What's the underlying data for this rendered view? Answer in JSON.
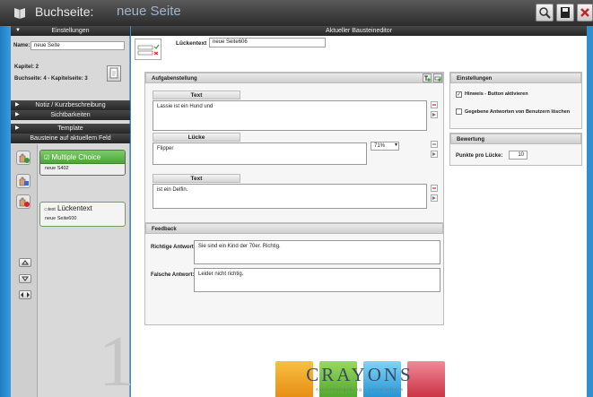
{
  "title": {
    "label": "Buchseite:",
    "value": "neue Seite"
  },
  "sidebar": {
    "settings_header": "Einstellungen",
    "name_label": "Name:",
    "name_value": "neue Seite",
    "chapter": "Kapitel: 2",
    "page_info": "Buchseite: 4  -  Kapitelseite: 3",
    "notes_header": "Notiz / Kurzbeschreibung",
    "visibility_header": "Sichtbarkeiten",
    "template_header": "Template",
    "blocks_header": "Bausteine auf aktuellem Feld",
    "blocks": [
      {
        "title": "Multiple Choice",
        "sub": "neue S402"
      },
      {
        "title": "Lückentext",
        "sub": "neue Seite600"
      }
    ],
    "watermark": "1"
  },
  "editor": {
    "header": "Aktueller Bausteineditor",
    "field_label": "Lückentext",
    "field_value": "neue Seite606",
    "task_header": "Aufgabenstellung",
    "blocks": [
      {
        "head": "Text",
        "content": "Lassie ist ein Hund und"
      },
      {
        "head": "Lücke",
        "content": "Flipper",
        "select": "71%"
      },
      {
        "head": "Text",
        "content": "ist ein Delfin."
      }
    ],
    "feedback_header": "Feedback",
    "correct_label": "Richtige Antwort:",
    "correct_text": "Sie sind ein Kind der 70er. Richtig.",
    "wrong_label": "Falsche Antwort:",
    "wrong_text": "Leider nicht richtig."
  },
  "settings_panel": {
    "header": "Einstellungen",
    "check1": "Hinweis - Button aktivieren",
    "check2": "Gegebene Antworten von Benutzern löschen",
    "rating_header": "Bewertung",
    "points_label": "Punkte pro Lücke:",
    "points_value": "10"
  },
  "logo": {
    "name": "CRAYONS",
    "tagline": "Autorenumgebung - Lernplattform"
  },
  "colors": {
    "accent_blue": "#2f8fd0",
    "mc_green": "#5cb84a",
    "crayon_orange": "#f0a020",
    "crayon_green": "#6abf3a",
    "crayon_blue": "#3aa8e0",
    "crayon_red": "#e04a5a"
  }
}
